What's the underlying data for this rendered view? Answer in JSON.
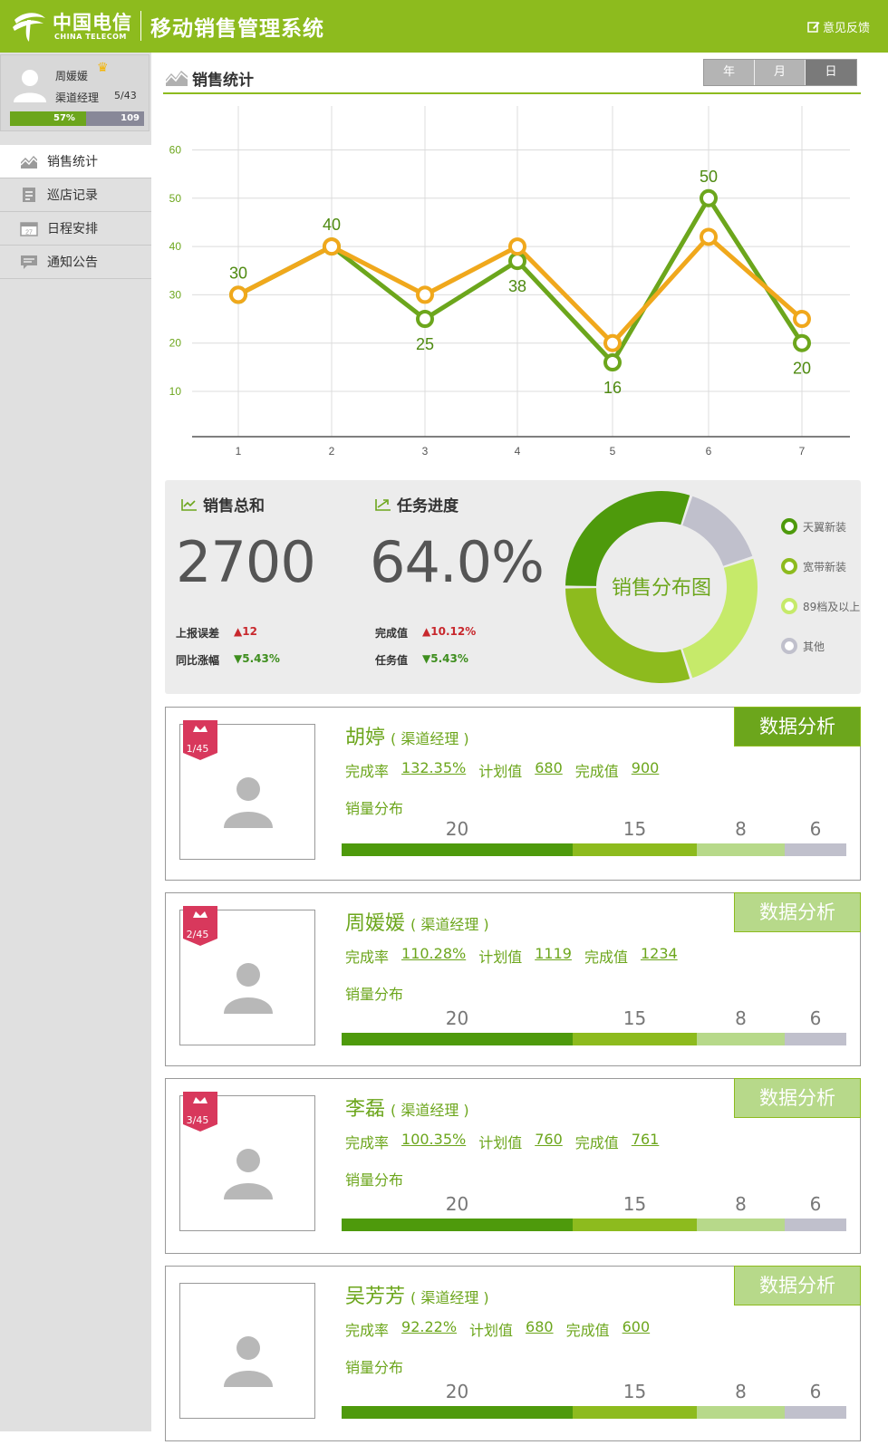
{
  "header": {
    "logo_cn": "中国电信",
    "logo_en": "CHINA TELECOM",
    "system_title": "移动销售管理系统",
    "feedback": "意见反馈"
  },
  "user": {
    "name": "周媛媛",
    "role": "渠道经理",
    "rank": "5/43",
    "progress_label": "57%",
    "progress_fraction": 0.57,
    "count": "109"
  },
  "nav": [
    {
      "label": "销售统计",
      "icon": "chart-area-icon",
      "active": true
    },
    {
      "label": "巡店记录",
      "icon": "document-icon",
      "active": false
    },
    {
      "label": "日程安排",
      "icon": "calendar-icon",
      "active": false
    },
    {
      "label": "通知公告",
      "icon": "message-icon",
      "active": false
    }
  ],
  "section": {
    "title": "销售统计",
    "periods": [
      "年",
      "月",
      "日"
    ],
    "active_period": "日"
  },
  "chart_data": {
    "type": "line",
    "x": [
      1,
      2,
      3,
      4,
      5,
      6,
      7
    ],
    "y_ticks": [
      10,
      20,
      30,
      40,
      50,
      60
    ],
    "ylim": [
      0,
      60
    ],
    "grid": true,
    "series": [
      {
        "color": "#6ca61c",
        "values": [
          30,
          40,
          25,
          37,
          16,
          50,
          20
        ],
        "labels": [
          "30",
          "40",
          "25",
          "38",
          "16",
          "50",
          "20"
        ]
      },
      {
        "color": "#f0a81c",
        "values": [
          30,
          40,
          30,
          40,
          20,
          42,
          25
        ]
      }
    ]
  },
  "summary": {
    "sales_total_label": "销售总和",
    "sales_total": "2700",
    "report_error_label": "上报误差",
    "report_error": "▲12",
    "yoy_label": "同比涨幅",
    "yoy": "▼5.43%",
    "task_label": "任务进度",
    "task_progress": "64.0%",
    "done_label": "完成值",
    "done": "▲10.12%",
    "task_value_label": "任务值",
    "task_value": "▼5.43%",
    "donut_title": "销售分布图",
    "donut": [
      {
        "name": "天翼新装",
        "value": 0.3,
        "color": "#4e9a0c"
      },
      {
        "name": "宽带新装",
        "value": 0.3,
        "color": "#8dbb1e"
      },
      {
        "name": "89档及以上",
        "value": 0.25,
        "color": "#c6ea6a"
      },
      {
        "name": "其他",
        "value": 0.15,
        "color": "#c0c0cc"
      }
    ]
  },
  "people": [
    {
      "rank": "1/45",
      "name": "胡婷",
      "role": "( 渠道经理 )",
      "rate_label": "完成率",
      "rate": "132.35%",
      "plan_label": "计划值",
      "plan": "680",
      "done_label": "完成值",
      "done": "900",
      "dist_label": "销量分布",
      "dist": [
        "20",
        "15",
        "8",
        "6"
      ],
      "button": "数据分析"
    },
    {
      "rank": "2/45",
      "name": "周媛媛",
      "role": "( 渠道经理 )",
      "rate_label": "完成率",
      "rate": "110.28%",
      "plan_label": "计划值",
      "plan": "1119",
      "done_label": "完成值",
      "done": "1234",
      "dist_label": "销量分布",
      "dist": [
        "20",
        "15",
        "8",
        "6"
      ],
      "button": "数据分析"
    },
    {
      "rank": "3/45",
      "name": "李磊",
      "role": "( 渠道经理 )",
      "rate_label": "完成率",
      "rate": "100.35%",
      "plan_label": "计划值",
      "plan": "760",
      "done_label": "完成值",
      "done": "761",
      "dist_label": "销量分布",
      "dist": [
        "20",
        "15",
        "8",
        "6"
      ],
      "button": "数据分析"
    },
    {
      "rank": "",
      "name": "吴芳芳",
      "role": "( 渠道经理 )",
      "rate_label": "完成率",
      "rate": "92.22%",
      "plan_label": "计划值",
      "plan": "680",
      "done_label": "完成值",
      "done": "600",
      "dist_label": "销量分布",
      "dist": [
        "20",
        "15",
        "8",
        "6"
      ],
      "button": "数据分析"
    }
  ]
}
